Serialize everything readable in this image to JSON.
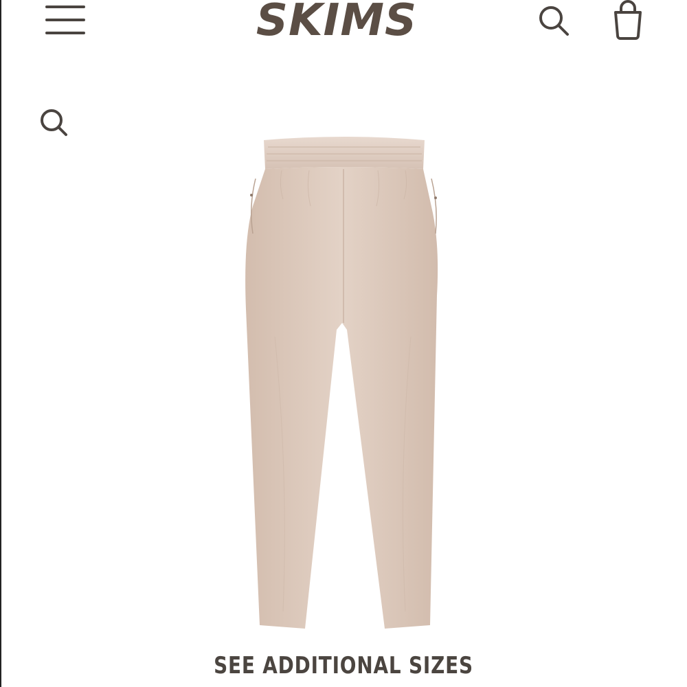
{
  "header": {
    "logo_text": "SKIMS",
    "menu_icon": "hamburger-menu-icon",
    "search_icon": "search-icon",
    "bag_icon": "shopping-bag-icon"
  },
  "secondary_search": {
    "icon": "search-icon"
  },
  "product": {
    "image_description_icon": "pants-image"
  },
  "cta": {
    "see_sizes_label": "SEE ADDITIONAL SIZES"
  },
  "colors": {
    "brand": "#5b4e45",
    "icon": "#4a4440",
    "product_fabric": "#dcc8bb"
  }
}
